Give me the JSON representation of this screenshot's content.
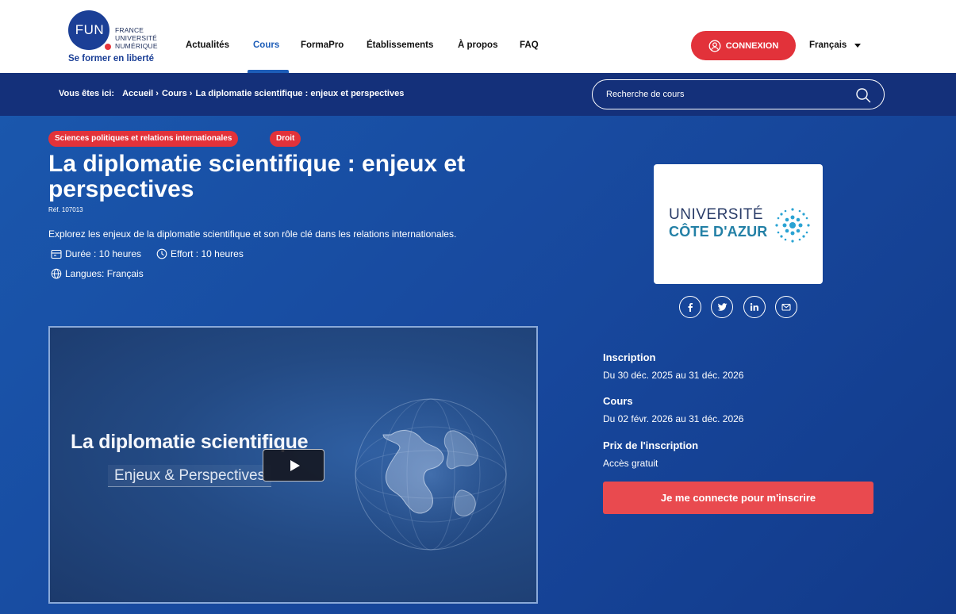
{
  "brand": {
    "logo_text": "FUN",
    "logo_words": [
      "FRANCE",
      "UNIVERSITÉ",
      "NUMÉRIQUE"
    ],
    "tagline": "Se former en liberté"
  },
  "nav": {
    "items": [
      {
        "label": "Actualités"
      },
      {
        "label": "Cours",
        "active": true
      },
      {
        "label": "FormaPro"
      },
      {
        "label": "Établissements"
      },
      {
        "label": "À propos"
      },
      {
        "label": "FAQ"
      }
    ],
    "login_label": "CONNEXION",
    "language": "Français"
  },
  "breadcrumb": {
    "prefix": "Vous êtes ici:",
    "items": [
      "Accueil ›",
      "Cours ›",
      "La diplomatie scientifique : enjeux et perspectives"
    ]
  },
  "search": {
    "placeholder": "Recherche de cours",
    "value": ""
  },
  "course": {
    "tags": [
      "Sciences politiques et relations internationales",
      "Droit"
    ],
    "title": "La diplomatie scientifique : enjeux et perspectives",
    "ref": "Réf. 107013",
    "description": "Explorez les enjeux de la diplomatie scientifique et son rôle clé dans les relations internationales.",
    "duration": "Durée : 10 heures",
    "effort": "Effort : 10 heures",
    "languages": "Langues: Français"
  },
  "video": {
    "title": "La diplomatie scientifique",
    "subtitle": "Enjeux & Perspectives"
  },
  "organization": {
    "line1": "UNIVERSITÉ",
    "line2": "CÔTE D'AZUR"
  },
  "share": {
    "icons": [
      "facebook-icon",
      "twitter-icon",
      "linkedin-icon",
      "email-icon"
    ]
  },
  "info": {
    "inscription_label": "Inscription",
    "inscription_value": "Du 30 déc. 2025 au 31 déc. 2026",
    "cours_label": "Cours",
    "cours_value": "Du 02 févr. 2026 au 31 déc. 2026",
    "price_label": "Prix de l'inscription",
    "price_value": "Accès gratuit",
    "enroll_label": "Je me connecte pour m'inscrire"
  },
  "colors": {
    "accent_red": "#e2323a",
    "nav_active": "#1d5db8",
    "breadcrumb_bg": "#14307a",
    "hero_bg": "#17479c"
  }
}
